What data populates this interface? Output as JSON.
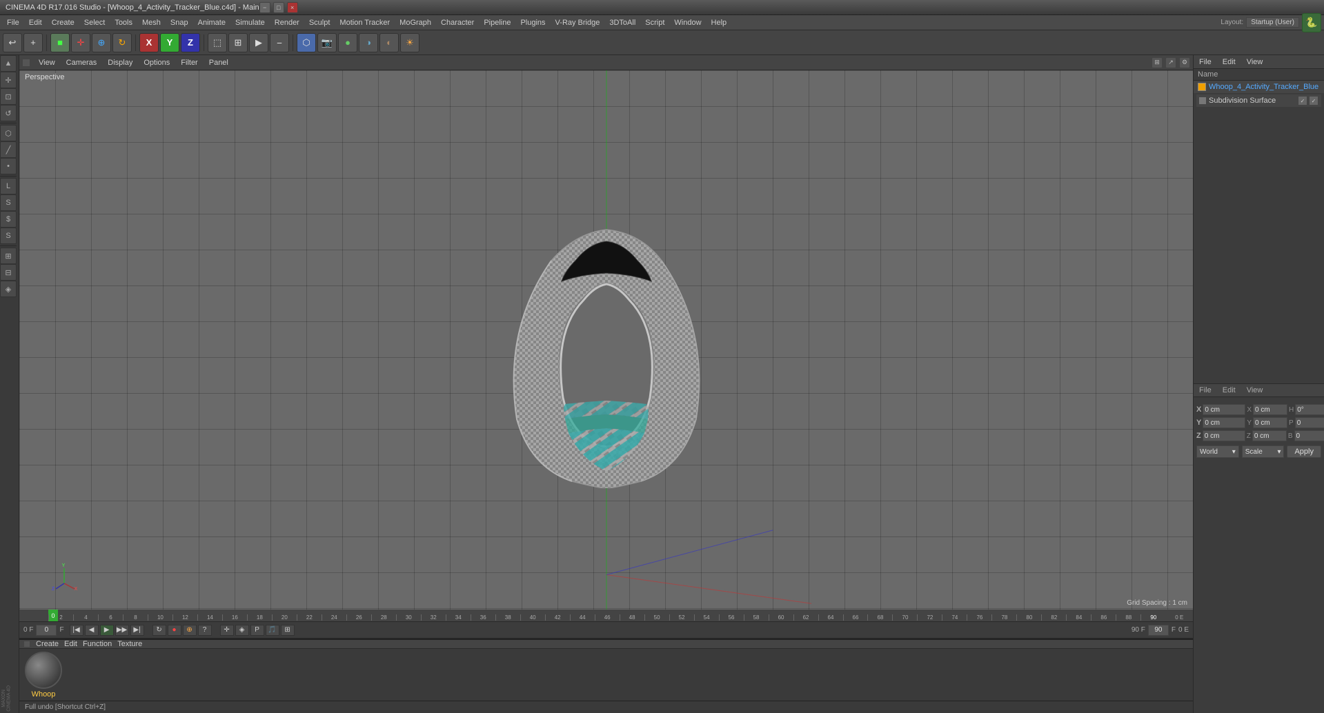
{
  "titlebar": {
    "title": "CINEMA 4D R17.016 Studio - [Whoop_4_Activity_Tracker_Blue.c4d] - Main",
    "min_btn": "−",
    "max_btn": "□",
    "close_btn": "×"
  },
  "menubar": {
    "items": [
      "File",
      "Edit",
      "Create",
      "Select",
      "Tools",
      "Mesh",
      "Snap",
      "Animate",
      "Simulate",
      "Render",
      "Sculpt",
      "Motion Tracker",
      "MoGraph",
      "Character",
      "Pipeline",
      "Plugins",
      "V-Ray Bridge",
      "3DToAll",
      "Script",
      "Window",
      "Help"
    ]
  },
  "toolbar": {
    "layout_label": "Layout: Startup (User)"
  },
  "viewport": {
    "label": "Perspective",
    "grid_spacing": "Grid Spacing : 1 cm",
    "toolbar_items": [
      "View",
      "Cameras",
      "Display",
      "Options",
      "Filter",
      "Panel"
    ]
  },
  "right_panel": {
    "subdivision_surface": "Subdivision Surface",
    "file_menu": [
      "File",
      "Edit",
      "View"
    ],
    "name_header": "Name",
    "object_name": "Whoop_4_Activity_Tracker_Blue",
    "attributes": {
      "menu_items": [
        "File",
        "Edit",
        "View"
      ],
      "coords": {
        "x_pos": "0 cm",
        "y_pos": "0 cm",
        "z_pos": "0 cm",
        "x_rot": "0 cm",
        "y_rot": "0 cm",
        "z_rot": "0 cm",
        "h_val": "0°",
        "p_val": "0",
        "b_val": "0",
        "coord_mode": "World",
        "scale_mode": "Scale"
      }
    },
    "apply_btn": "Apply"
  },
  "timeline": {
    "ruler_labels": [
      "0",
      "2",
      "4",
      "6",
      "8",
      "10",
      "12",
      "14",
      "16",
      "18",
      "20",
      "22",
      "24",
      "26",
      "28",
      "30",
      "32",
      "34",
      "36",
      "38",
      "40",
      "42",
      "44",
      "46",
      "48",
      "50",
      "52",
      "54",
      "56",
      "58",
      "60",
      "62",
      "64",
      "66",
      "68",
      "70",
      "72",
      "74",
      "76",
      "78",
      "80",
      "82",
      "84",
      "86",
      "88",
      "90"
    ],
    "start_frame": "0 F",
    "end_frame": "90 F",
    "current_frame": "0 F",
    "fps": "0 F"
  },
  "material_panel": {
    "menu_items": [
      "Create",
      "Edit",
      "Function",
      "Texture"
    ],
    "material_name": "Whoop"
  },
  "statusbar": {
    "text": "Full undo [Shortcut Ctrl+Z]"
  }
}
